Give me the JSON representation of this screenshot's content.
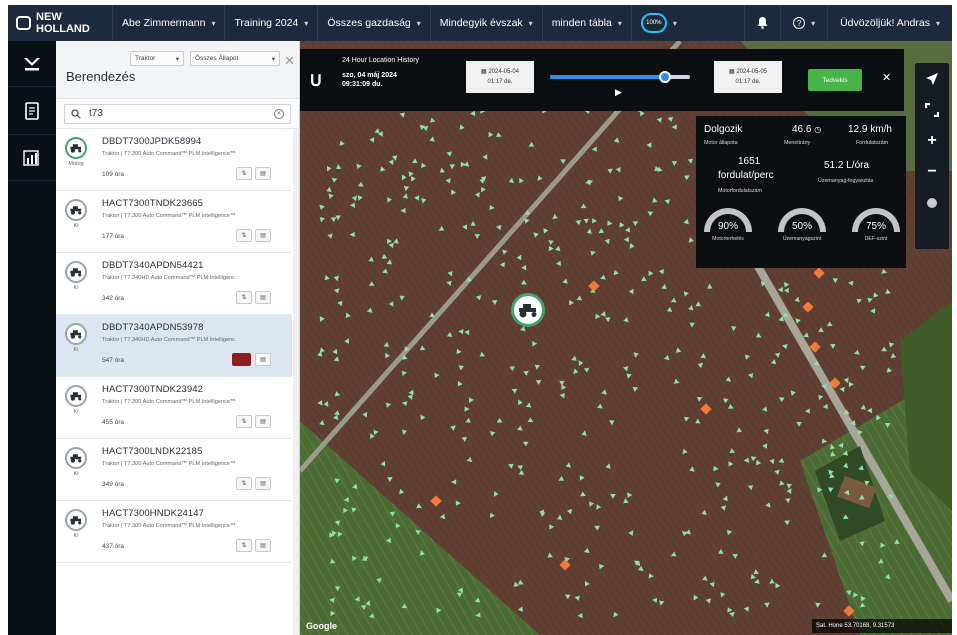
{
  "brand": {
    "name": "NEW HOLLAND"
  },
  "topnav": {
    "items": [
      {
        "label": "Abe Zimmermann"
      },
      {
        "label": "Training 2024"
      },
      {
        "label": "Összes gazdaság"
      },
      {
        "label": "Mindegyik évszak"
      },
      {
        "label": "minden tábla"
      }
    ],
    "zoom_label": "100%",
    "greeting": "Üdvözöljük! Andras"
  },
  "panel": {
    "title": "Berendezés",
    "filter_type": "Traktor",
    "filter_state": "Összes Állapot",
    "search_value": "t73",
    "items": [
      {
        "name": "DBDT7300JPDK58994",
        "model": "Traktor | T7.300 Auto Command™ PLM Intelligence™",
        "hours": "109 óra",
        "state": "Motog",
        "selected": false
      },
      {
        "name": "HACT7300TNDK23665",
        "model": "Traktor | T7.300 Auto Command™ PLM Intelligence™",
        "hours": "177 óra",
        "state": "Ki",
        "selected": false
      },
      {
        "name": "DBDT7340APDN54421",
        "model": "Traktor | T7.340HD Auto Command™ PLM Intelligenc",
        "hours": "342 óra",
        "state": "Ki",
        "selected": false
      },
      {
        "name": "DBDT7340APDN53978",
        "model": "Traktor | T7.340HD Auto Command™ PLM Intelligenc",
        "hours": "547 óra",
        "state": "Ki",
        "selected": true
      },
      {
        "name": "HACT7300TNDK23942",
        "model": "Traktor | T7.300 Auto Command™ PLM Intelligence™",
        "hours": "455 óra",
        "state": "Ki",
        "selected": false
      },
      {
        "name": "HACT7300LNDK22185",
        "model": "Traktor | T7.300 Auto Command™ PLM Intelligence™",
        "hours": "349 óra",
        "state": "Ki",
        "selected": false
      },
      {
        "name": "HACT7300HNDK24147",
        "model": "Traktor | T7.300 Auto Command™ PLM Intelligence™",
        "hours": "437 óra",
        "state": "Ki",
        "selected": false
      }
    ]
  },
  "timeline": {
    "title": "24 Hour Location History",
    "date_line1": "szo, 04 máj 2024",
    "date_line2": "09:31:09 du.",
    "start_date": "2024-05-04",
    "start_time": "01:17 de.",
    "end_date": "2024-05-05",
    "end_time": "01:17 de.",
    "progress": 0.82,
    "apply_label": "Tedvekis"
  },
  "stats": {
    "status": "Dolgozik",
    "status_label": "Motor állapota",
    "load": "46.6",
    "load_label": "Menetirány",
    "speed": "12.9 km/h",
    "speed_label": "Fordulatszám",
    "rpm": "1651",
    "rpm_unit": "fordulat/perc",
    "rpm_label": "Motorfordulatszám",
    "fuel_rate": "51.2 L/óra",
    "fuel_rate_label": "Üzemanyag-fogyasztás",
    "gauges": [
      {
        "value": "90%",
        "label": "Motorterhelés"
      },
      {
        "value": "50%",
        "label": "Üzemanyagszint"
      },
      {
        "value": "75%",
        "label": "DEF-szint"
      }
    ]
  },
  "map": {
    "google_label": "Google",
    "coords_label": "Sat. Hone   53.70168, 9.31573"
  },
  "colors": {
    "accent_blue": "#2d8ef0",
    "accent_green": "#47b349",
    "selected_red": "#8b1f1f",
    "field_line_red": "#c0392b",
    "point_green": "#8de0a8",
    "marker_orange": "#f07a3a"
  }
}
